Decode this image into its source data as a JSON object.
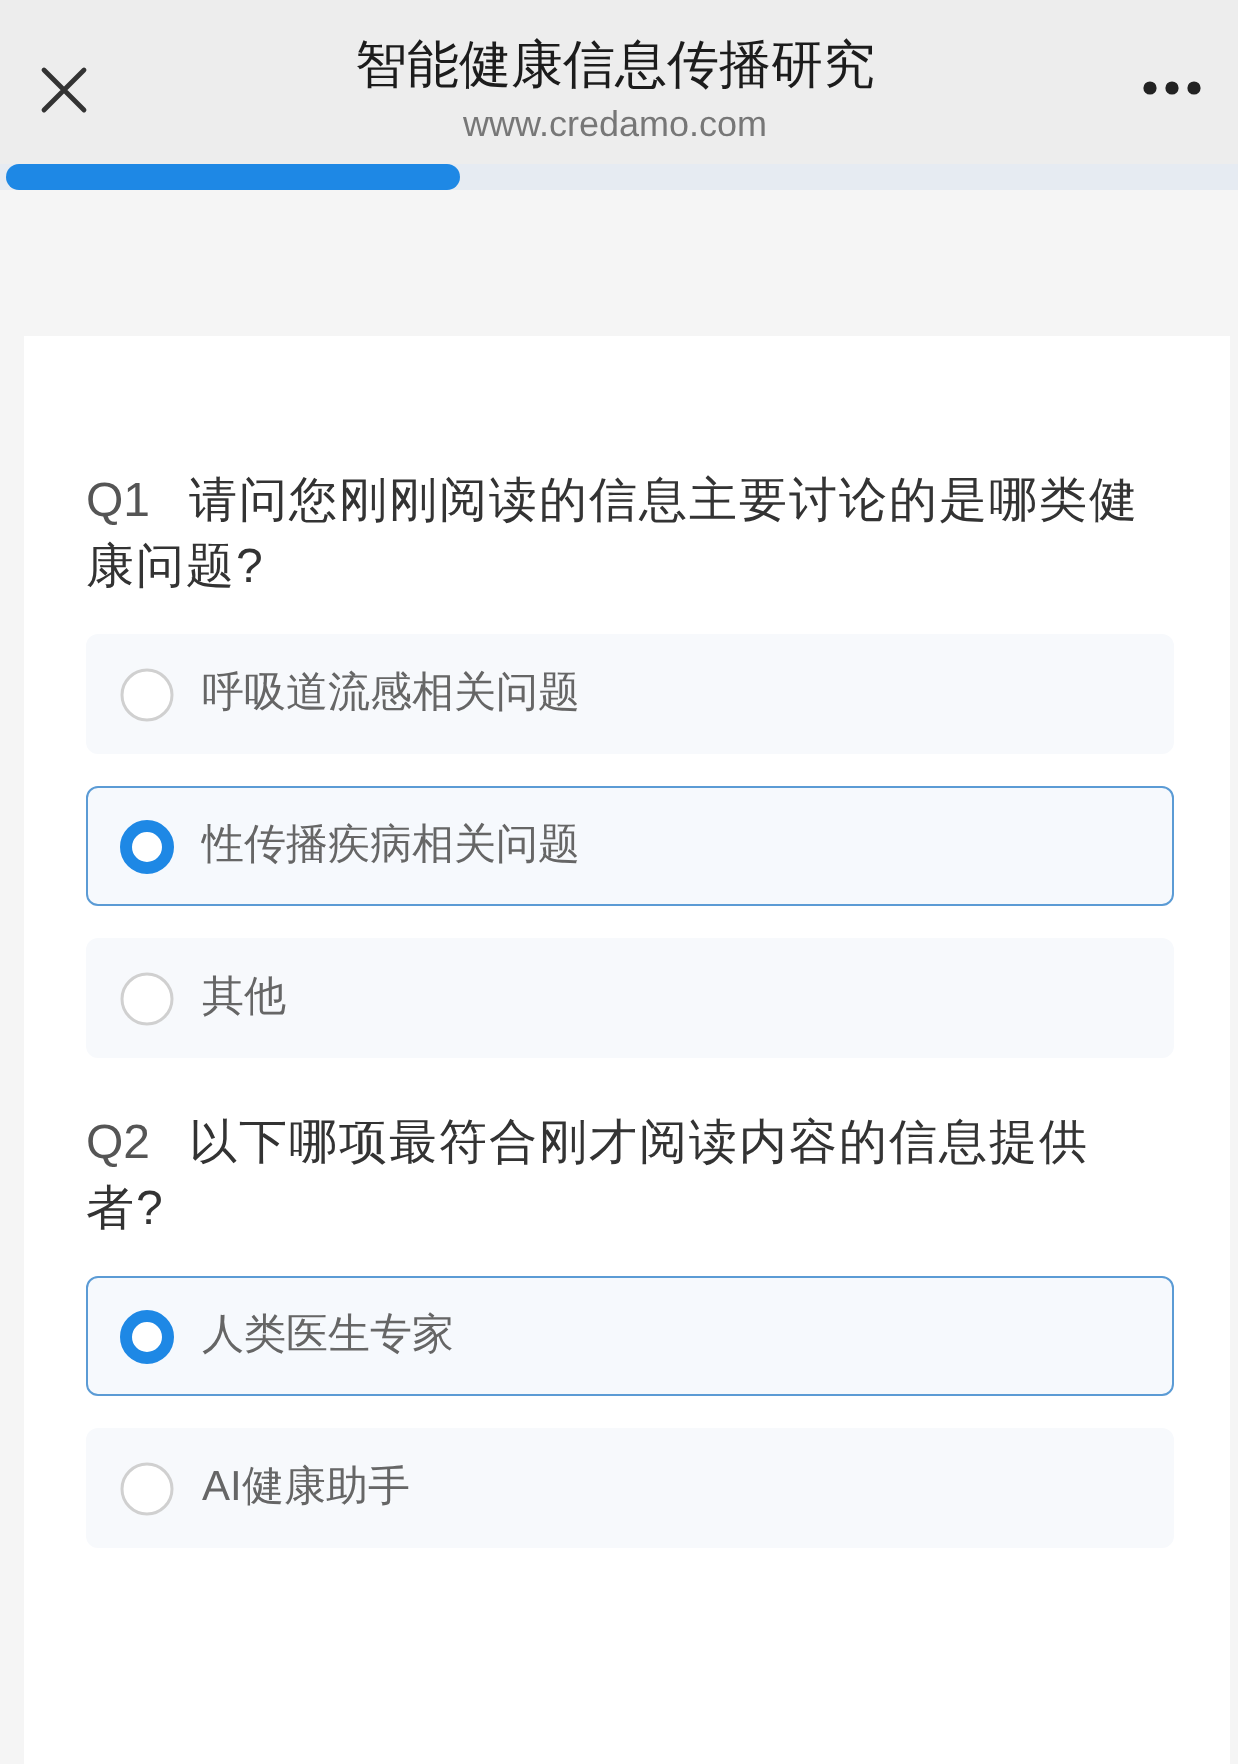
{
  "header": {
    "title": "智能健康信息传播研究",
    "url": "www.credamo.com"
  },
  "progress": {
    "level": 0.37
  },
  "questions": [
    {
      "number": "Q1",
      "text": "请问您刚刚阅读的信息主要讨论的是哪类健康问题?",
      "options": [
        {
          "label": "呼吸道流感相关问题",
          "selected": false
        },
        {
          "label": "性传播疾病相关问题",
          "selected": true
        },
        {
          "label": "其他",
          "selected": false
        }
      ]
    },
    {
      "number": "Q2",
      "text": "以下哪项最符合刚才阅读内容的信息提供者?",
      "options": [
        {
          "label": "人类医生专家",
          "selected": true
        },
        {
          "label": "AI健康助手",
          "selected": false
        }
      ]
    }
  ]
}
